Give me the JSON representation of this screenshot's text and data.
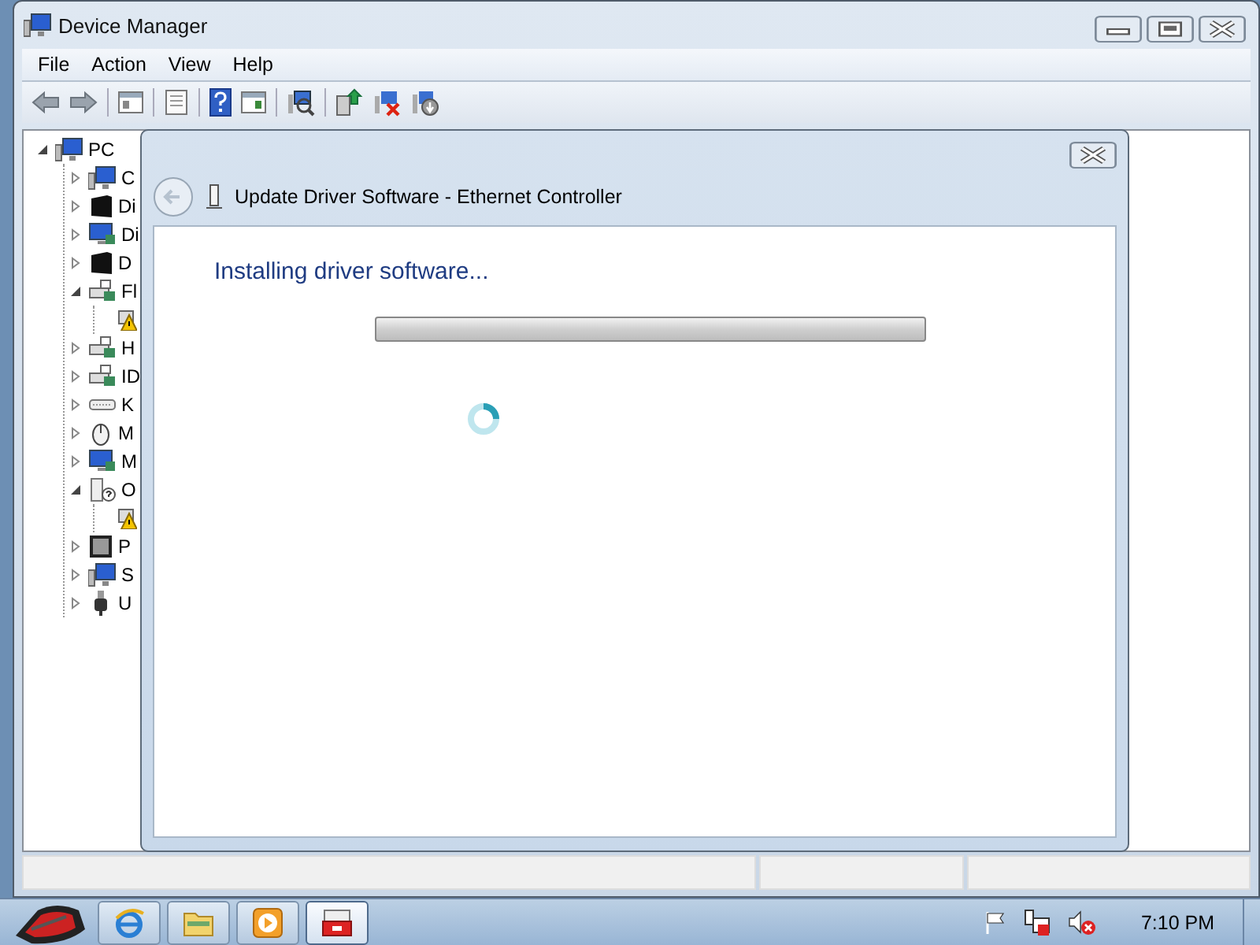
{
  "window": {
    "title": "Device Manager"
  },
  "menu": [
    "File",
    "Action",
    "View",
    "Help"
  ],
  "toolbar": [
    {
      "kind": "back"
    },
    {
      "kind": "forward"
    },
    {
      "kind": "sep"
    },
    {
      "kind": "tree"
    },
    {
      "kind": "sep"
    },
    {
      "kind": "properties"
    },
    {
      "kind": "sep"
    },
    {
      "kind": "help"
    },
    {
      "kind": "pane"
    },
    {
      "kind": "sep"
    },
    {
      "kind": "scan"
    },
    {
      "kind": "sep"
    },
    {
      "kind": "update"
    },
    {
      "kind": "uninstall"
    },
    {
      "kind": "disable"
    }
  ],
  "tree": {
    "label": "PC",
    "kind": "computer",
    "expanded": true,
    "children": [
      {
        "label": "C",
        "kind": "computer",
        "expanded": false
      },
      {
        "label": "Di",
        "kind": "drive",
        "expanded": false
      },
      {
        "label": "Di",
        "kind": "display",
        "expanded": false
      },
      {
        "label": "D",
        "kind": "drive",
        "expanded": false
      },
      {
        "label": "Fl",
        "kind": "controller",
        "expanded": true,
        "children": [
          {
            "kind": "warning"
          }
        ]
      },
      {
        "label": "H",
        "kind": "controller",
        "expanded": false
      },
      {
        "label": "ID",
        "kind": "controller",
        "expanded": false
      },
      {
        "label": "K",
        "kind": "keyboard",
        "expanded": false
      },
      {
        "label": "M",
        "kind": "mouse",
        "expanded": false
      },
      {
        "label": "M",
        "kind": "display",
        "expanded": false
      },
      {
        "label": "O",
        "kind": "unknown",
        "expanded": true,
        "children": [
          {
            "kind": "warning"
          }
        ]
      },
      {
        "label": "P",
        "kind": "chip",
        "expanded": false
      },
      {
        "label": "S",
        "kind": "computer",
        "expanded": false
      },
      {
        "label": "U",
        "kind": "usb",
        "expanded": false
      }
    ]
  },
  "dialog": {
    "title": "Update Driver Software - Ethernet Controller",
    "heading": "Installing driver software...",
    "progress": {
      "level": 0
    }
  },
  "taskbar": {
    "buttons": [
      {
        "kind": "browser",
        "selected": false
      },
      {
        "kind": "folder",
        "selected": false
      },
      {
        "kind": "media",
        "selected": false
      },
      {
        "kind": "device",
        "selected": true
      }
    ],
    "tray": [
      {
        "kind": "flag"
      },
      {
        "kind": "network"
      },
      {
        "kind": "speaker-muted"
      }
    ],
    "clock": "7:10 PM"
  }
}
